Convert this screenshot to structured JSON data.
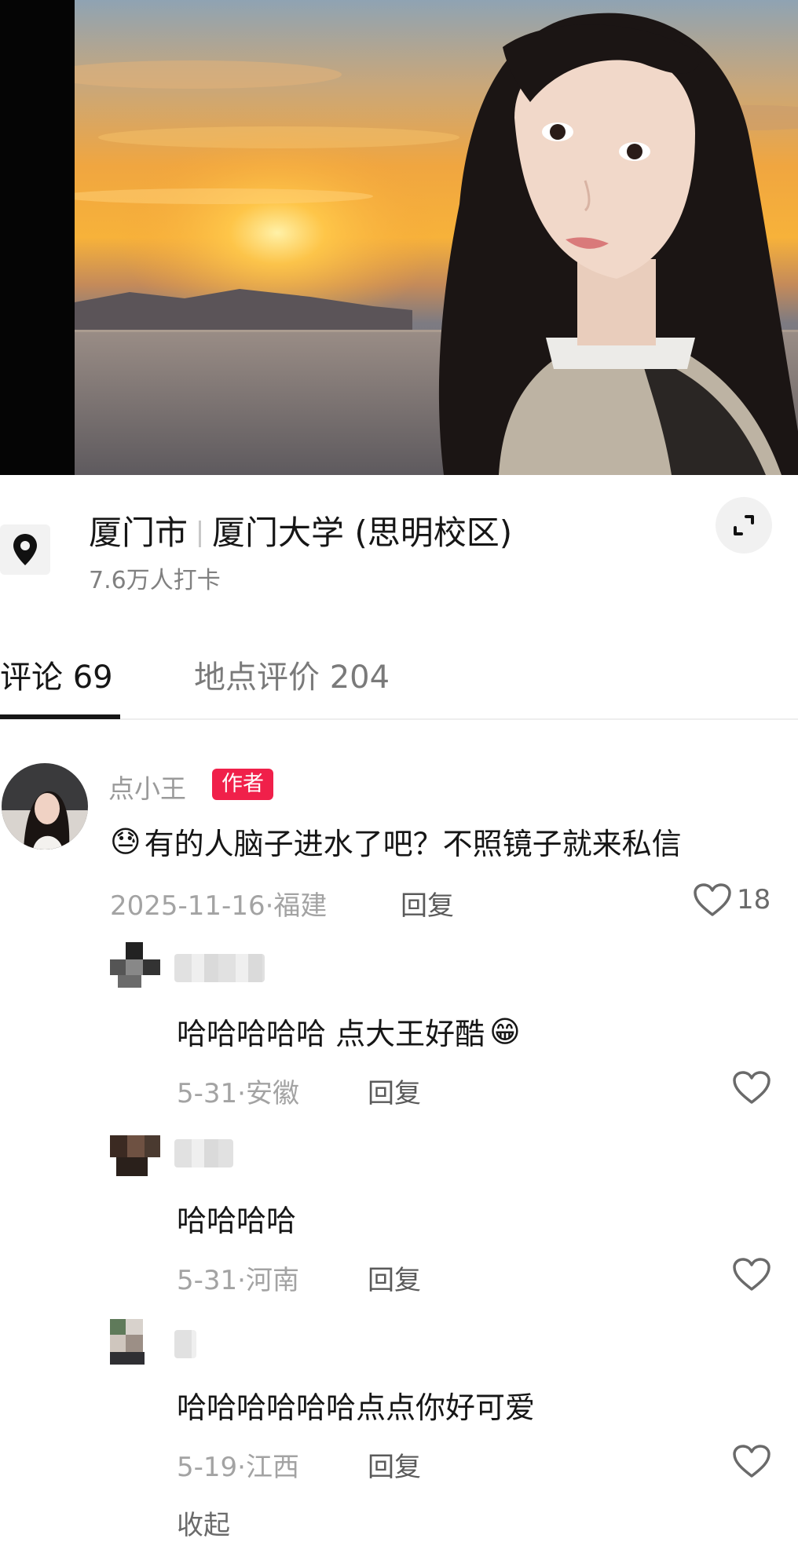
{
  "location": {
    "city": "厦门市",
    "place": "厦门大学 (思明校区)",
    "checkins": "7.6万人打卡",
    "pin_icon": "location-pin-icon",
    "expand_icon": "expand-icon"
  },
  "tabs": [
    {
      "label": "评论 69",
      "active": true
    },
    {
      "label": "地点评价 204",
      "active": false
    }
  ],
  "comments": [
    {
      "username": "点小王",
      "badge": "作者",
      "emoji": "😓",
      "text": "有的人脑子进水了吧？不照镜子就来私信",
      "date": "2025-11-16",
      "region": "福建",
      "reply_label": "回复",
      "likes": "18"
    }
  ],
  "replies": [
    {
      "text": "哈哈哈哈哈 点大王好酷",
      "emoji": "😁",
      "date": "5-31",
      "region": "安徽",
      "reply_label": "回复"
    },
    {
      "text": "哈哈哈哈",
      "date": "5-31",
      "region": "河南",
      "reply_label": "回复"
    },
    {
      "text": "哈哈哈哈哈哈点点你好可爱",
      "date": "5-19",
      "region": "江西",
      "reply_label": "回复"
    }
  ],
  "collapse_label": "收起",
  "colors": {
    "author_badge": "#f0204a",
    "active_tab": "#161616"
  }
}
